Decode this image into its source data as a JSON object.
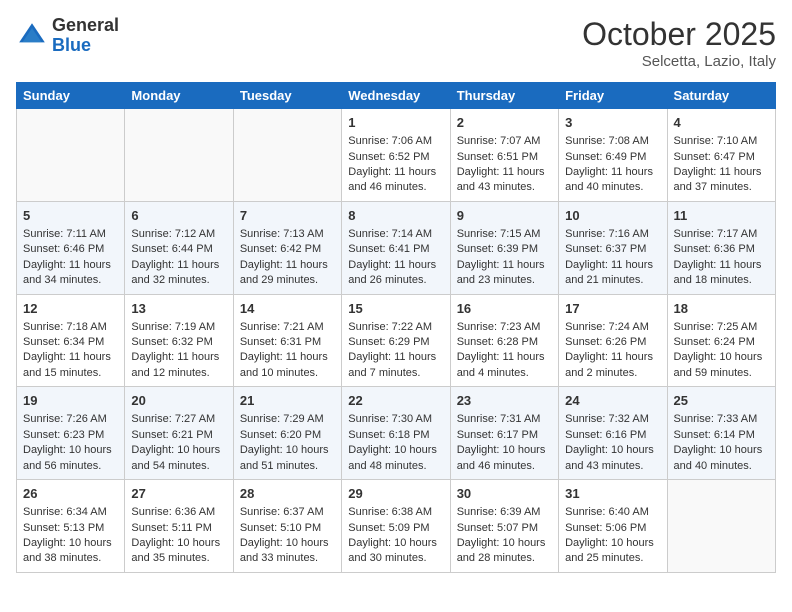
{
  "header": {
    "logo_general": "General",
    "logo_blue": "Blue",
    "month_title": "October 2025",
    "subtitle": "Selcetta, Lazio, Italy"
  },
  "weekdays": [
    "Sunday",
    "Monday",
    "Tuesday",
    "Wednesday",
    "Thursday",
    "Friday",
    "Saturday"
  ],
  "weeks": [
    [
      {
        "day": "",
        "info": ""
      },
      {
        "day": "",
        "info": ""
      },
      {
        "day": "",
        "info": ""
      },
      {
        "day": "1",
        "info": "Sunrise: 7:06 AM\nSunset: 6:52 PM\nDaylight: 11 hours and 46 minutes."
      },
      {
        "day": "2",
        "info": "Sunrise: 7:07 AM\nSunset: 6:51 PM\nDaylight: 11 hours and 43 minutes."
      },
      {
        "day": "3",
        "info": "Sunrise: 7:08 AM\nSunset: 6:49 PM\nDaylight: 11 hours and 40 minutes."
      },
      {
        "day": "4",
        "info": "Sunrise: 7:10 AM\nSunset: 6:47 PM\nDaylight: 11 hours and 37 minutes."
      }
    ],
    [
      {
        "day": "5",
        "info": "Sunrise: 7:11 AM\nSunset: 6:46 PM\nDaylight: 11 hours and 34 minutes."
      },
      {
        "day": "6",
        "info": "Sunrise: 7:12 AM\nSunset: 6:44 PM\nDaylight: 11 hours and 32 minutes."
      },
      {
        "day": "7",
        "info": "Sunrise: 7:13 AM\nSunset: 6:42 PM\nDaylight: 11 hours and 29 minutes."
      },
      {
        "day": "8",
        "info": "Sunrise: 7:14 AM\nSunset: 6:41 PM\nDaylight: 11 hours and 26 minutes."
      },
      {
        "day": "9",
        "info": "Sunrise: 7:15 AM\nSunset: 6:39 PM\nDaylight: 11 hours and 23 minutes."
      },
      {
        "day": "10",
        "info": "Sunrise: 7:16 AM\nSunset: 6:37 PM\nDaylight: 11 hours and 21 minutes."
      },
      {
        "day": "11",
        "info": "Sunrise: 7:17 AM\nSunset: 6:36 PM\nDaylight: 11 hours and 18 minutes."
      }
    ],
    [
      {
        "day": "12",
        "info": "Sunrise: 7:18 AM\nSunset: 6:34 PM\nDaylight: 11 hours and 15 minutes."
      },
      {
        "day": "13",
        "info": "Sunrise: 7:19 AM\nSunset: 6:32 PM\nDaylight: 11 hours and 12 minutes."
      },
      {
        "day": "14",
        "info": "Sunrise: 7:21 AM\nSunset: 6:31 PM\nDaylight: 11 hours and 10 minutes."
      },
      {
        "day": "15",
        "info": "Sunrise: 7:22 AM\nSunset: 6:29 PM\nDaylight: 11 hours and 7 minutes."
      },
      {
        "day": "16",
        "info": "Sunrise: 7:23 AM\nSunset: 6:28 PM\nDaylight: 11 hours and 4 minutes."
      },
      {
        "day": "17",
        "info": "Sunrise: 7:24 AM\nSunset: 6:26 PM\nDaylight: 11 hours and 2 minutes."
      },
      {
        "day": "18",
        "info": "Sunrise: 7:25 AM\nSunset: 6:24 PM\nDaylight: 10 hours and 59 minutes."
      }
    ],
    [
      {
        "day": "19",
        "info": "Sunrise: 7:26 AM\nSunset: 6:23 PM\nDaylight: 10 hours and 56 minutes."
      },
      {
        "day": "20",
        "info": "Sunrise: 7:27 AM\nSunset: 6:21 PM\nDaylight: 10 hours and 54 minutes."
      },
      {
        "day": "21",
        "info": "Sunrise: 7:29 AM\nSunset: 6:20 PM\nDaylight: 10 hours and 51 minutes."
      },
      {
        "day": "22",
        "info": "Sunrise: 7:30 AM\nSunset: 6:18 PM\nDaylight: 10 hours and 48 minutes."
      },
      {
        "day": "23",
        "info": "Sunrise: 7:31 AM\nSunset: 6:17 PM\nDaylight: 10 hours and 46 minutes."
      },
      {
        "day": "24",
        "info": "Sunrise: 7:32 AM\nSunset: 6:16 PM\nDaylight: 10 hours and 43 minutes."
      },
      {
        "day": "25",
        "info": "Sunrise: 7:33 AM\nSunset: 6:14 PM\nDaylight: 10 hours and 40 minutes."
      }
    ],
    [
      {
        "day": "26",
        "info": "Sunrise: 6:34 AM\nSunset: 5:13 PM\nDaylight: 10 hours and 38 minutes."
      },
      {
        "day": "27",
        "info": "Sunrise: 6:36 AM\nSunset: 5:11 PM\nDaylight: 10 hours and 35 minutes."
      },
      {
        "day": "28",
        "info": "Sunrise: 6:37 AM\nSunset: 5:10 PM\nDaylight: 10 hours and 33 minutes."
      },
      {
        "day": "29",
        "info": "Sunrise: 6:38 AM\nSunset: 5:09 PM\nDaylight: 10 hours and 30 minutes."
      },
      {
        "day": "30",
        "info": "Sunrise: 6:39 AM\nSunset: 5:07 PM\nDaylight: 10 hours and 28 minutes."
      },
      {
        "day": "31",
        "info": "Sunrise: 6:40 AM\nSunset: 5:06 PM\nDaylight: 10 hours and 25 minutes."
      },
      {
        "day": "",
        "info": ""
      }
    ]
  ]
}
